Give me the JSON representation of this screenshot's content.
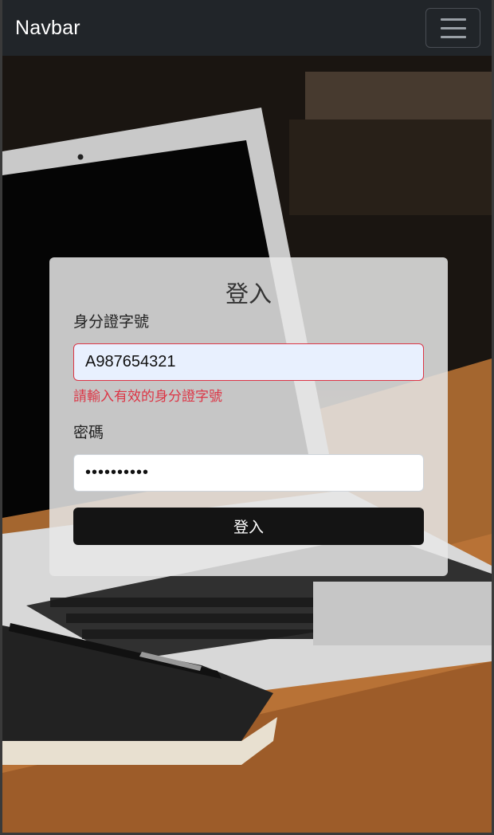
{
  "navbar": {
    "brand": "Navbar",
    "toggler_icon": "hamburger-icon"
  },
  "login": {
    "title": "登入",
    "id_label": "身分證字號",
    "id_value": "A987654321",
    "id_error": "請輸入有效的身分證字號",
    "password_label": "密碼",
    "password_value": "••••••••••",
    "submit_label": "登入"
  },
  "colors": {
    "navbar_bg": "#212529",
    "error": "#dc3545",
    "button_bg": "#141414",
    "autofill_bg": "#e8f0fe"
  }
}
